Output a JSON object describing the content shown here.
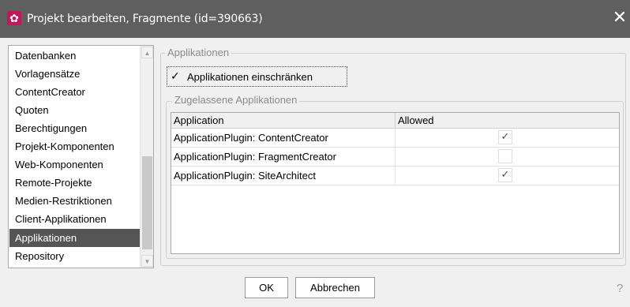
{
  "window": {
    "title": "Projekt bearbeiten, Fragmente (id=390663)",
    "app_icon": "gear-icon",
    "close_icon": "close-icon"
  },
  "nav": {
    "items": [
      {
        "label": "Datenbanken",
        "selected": false
      },
      {
        "label": "Vorlagensätze",
        "selected": false
      },
      {
        "label": "ContentCreator",
        "selected": false
      },
      {
        "label": "Quoten",
        "selected": false
      },
      {
        "label": "Berechtigungen",
        "selected": false
      },
      {
        "label": "Projekt-Komponenten",
        "selected": false
      },
      {
        "label": "Web-Komponenten",
        "selected": false
      },
      {
        "label": "Remote-Projekte",
        "selected": false
      },
      {
        "label": "Medien-Restriktionen",
        "selected": false
      },
      {
        "label": "Client-Applikationen",
        "selected": false
      },
      {
        "label": "Applikationen",
        "selected": true
      },
      {
        "label": "Repository",
        "selected": false
      }
    ]
  },
  "panel": {
    "legend": "Applikationen",
    "restrict_checkbox": {
      "label": "Applikationen einschränken",
      "checked": true,
      "mark": "✓"
    },
    "allowed_group": {
      "legend": "Zugelassene Applikationen",
      "columns": [
        "Application",
        "Allowed"
      ],
      "rows": [
        {
          "application": "ApplicationPlugin: ContentCreator",
          "allowed": true,
          "mark": "✓"
        },
        {
          "application": "ApplicationPlugin: FragmentCreator",
          "allowed": false,
          "mark": ""
        },
        {
          "application": "ApplicationPlugin: SiteArchitect",
          "allowed": true,
          "mark": "✓"
        }
      ]
    }
  },
  "buttons": {
    "ok": "OK",
    "cancel": "Abbrechen",
    "help": "?"
  },
  "colors": {
    "titlebar": "#5f5f5f",
    "selection": "#555555",
    "dialog_bg": "#f0f0f0",
    "icon_accent": "#c2185b"
  }
}
